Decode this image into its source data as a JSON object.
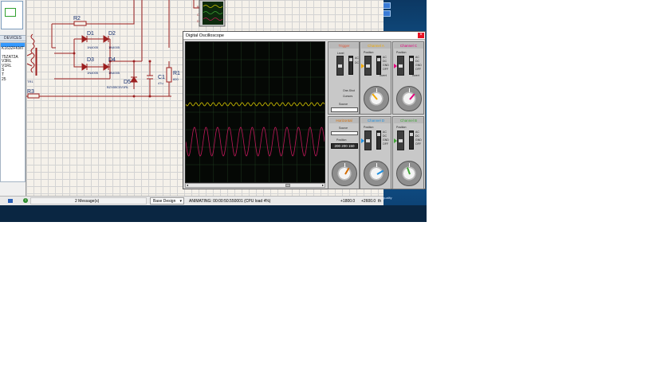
{
  "left_panel": {
    "devices_header": "DEVICES",
    "devices": [
      "",
      "K1632FKMT",
      "",
      "75ZAT2A",
      "V3RL",
      "V1RL",
      "S",
      "T",
      "25"
    ]
  },
  "schematic": {
    "refs": {
      "r2": "R2",
      "d1": "D1",
      "d2": "D2",
      "d3": "D3",
      "d4": "D4",
      "d5": "D5",
      "c1": "C1",
      "r1": "R1",
      "r3": "R3"
    },
    "parts": {
      "d1": "1N4005",
      "d2": "1N4005",
      "d3": "1N4005",
      "d4": "1N4005",
      "d5": "BZX55C5V1RL",
      "c1": "47u",
      "r1": "820",
      "tr": "TR1"
    }
  },
  "status_bar": {
    "messages": "2 Message(s)",
    "design": "Base Design",
    "dropdown_arrow": "▾",
    "animating": "ANIMATING: 00:00:50.550001 (CPU load 4%)",
    "x_coord": "+1800.0",
    "y_coord": "+2600.0",
    "unit": "th"
  },
  "oscilloscope": {
    "title": "Digital Oscilloscope",
    "close_glyph": "×",
    "channels": [
      {
        "name": "Channel A",
        "color": "#f2a900"
      },
      {
        "name": "Channel B",
        "color": "#3fa535"
      },
      {
        "name": "Channel C",
        "color": "#e4007c"
      },
      {
        "name": "Channel D",
        "color": "#1d8fe0"
      }
    ],
    "trigger_label": "Trigger",
    "horizontal_label": "Horizontal",
    "level_label": "Level",
    "source_label": "Source",
    "position_label": "Position",
    "one_shot_label": "One-Shot",
    "cursors_label": "Cursors",
    "ac_label": "AC",
    "dc_label": "DC",
    "gnd_label": "GND",
    "off_label": "OFF",
    "invert_label": "Invert",
    "position_value": "200 200 150",
    "dial_scales": {
      "low": [
        "0.5",
        "1",
        "2",
        "5"
      ],
      "high": [
        "mV",
        "V",
        "20"
      ]
    },
    "traces": {
      "yellow_color": "#d6c700",
      "magenta_color": "#c0185a",
      "yellow_cycles": 24,
      "magenta_cycles": 12
    }
  },
  "desktop": {
    "gadget_label": "quality"
  }
}
